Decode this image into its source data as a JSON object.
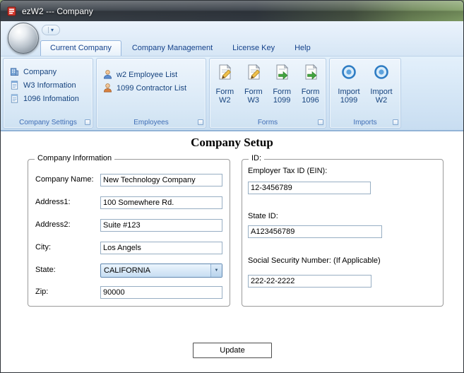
{
  "window": {
    "title": "ezW2 --- Company"
  },
  "icons": {
    "qat_dropdown": "▾",
    "combo_arrow": "▼"
  },
  "tabs": [
    {
      "label": "Current Company"
    },
    {
      "label": "Company Management"
    },
    {
      "label": "License Key"
    },
    {
      "label": "Help"
    }
  ],
  "ribbon": {
    "company_settings": {
      "label": "Company Settings",
      "items": [
        {
          "label": "Company"
        },
        {
          "label": "W3 Information"
        },
        {
          "label": "1096 Infomation"
        }
      ]
    },
    "employees": {
      "label": "Employees",
      "items": [
        {
          "label": "w2 Employee List"
        },
        {
          "label": "1099 Contractor List"
        }
      ]
    },
    "forms": {
      "label": "Forms",
      "items": [
        {
          "line1": "Form",
          "line2": "W2"
        },
        {
          "line1": "Form",
          "line2": "W3"
        },
        {
          "line1": "Form",
          "line2": "1099"
        },
        {
          "line1": "Form",
          "line2": "1096"
        }
      ]
    },
    "imports": {
      "label": "Imports",
      "items": [
        {
          "line1": "Import",
          "line2": "1099"
        },
        {
          "line1": "Import",
          "line2": "W2"
        }
      ]
    }
  },
  "main": {
    "title": "Company Setup",
    "company_info": {
      "legend": "Company Information",
      "fields": [
        {
          "label": "Company Name:",
          "value": "New Technology Company"
        },
        {
          "label": "Address1:",
          "value": "100 Somewhere Rd."
        },
        {
          "label": "Address2:",
          "value": "Suite #123"
        },
        {
          "label": "City:",
          "value": "Los Angels"
        },
        {
          "label": "State:",
          "value": "CALIFORNIA"
        },
        {
          "label": "Zip:",
          "value": "90000"
        }
      ]
    },
    "id_info": {
      "legend": "ID:",
      "fields": [
        {
          "label": "Employer Tax ID (EIN):",
          "value": "12-3456789"
        },
        {
          "label": "State ID:",
          "value": "A123456789"
        },
        {
          "label": "Social Security Number: (If Applicable)",
          "value": "222-22-2222"
        }
      ]
    },
    "update_button": "Update"
  },
  "colors": {
    "accent_blue": "#15428b",
    "group_label_blue": "#3f6db5"
  }
}
